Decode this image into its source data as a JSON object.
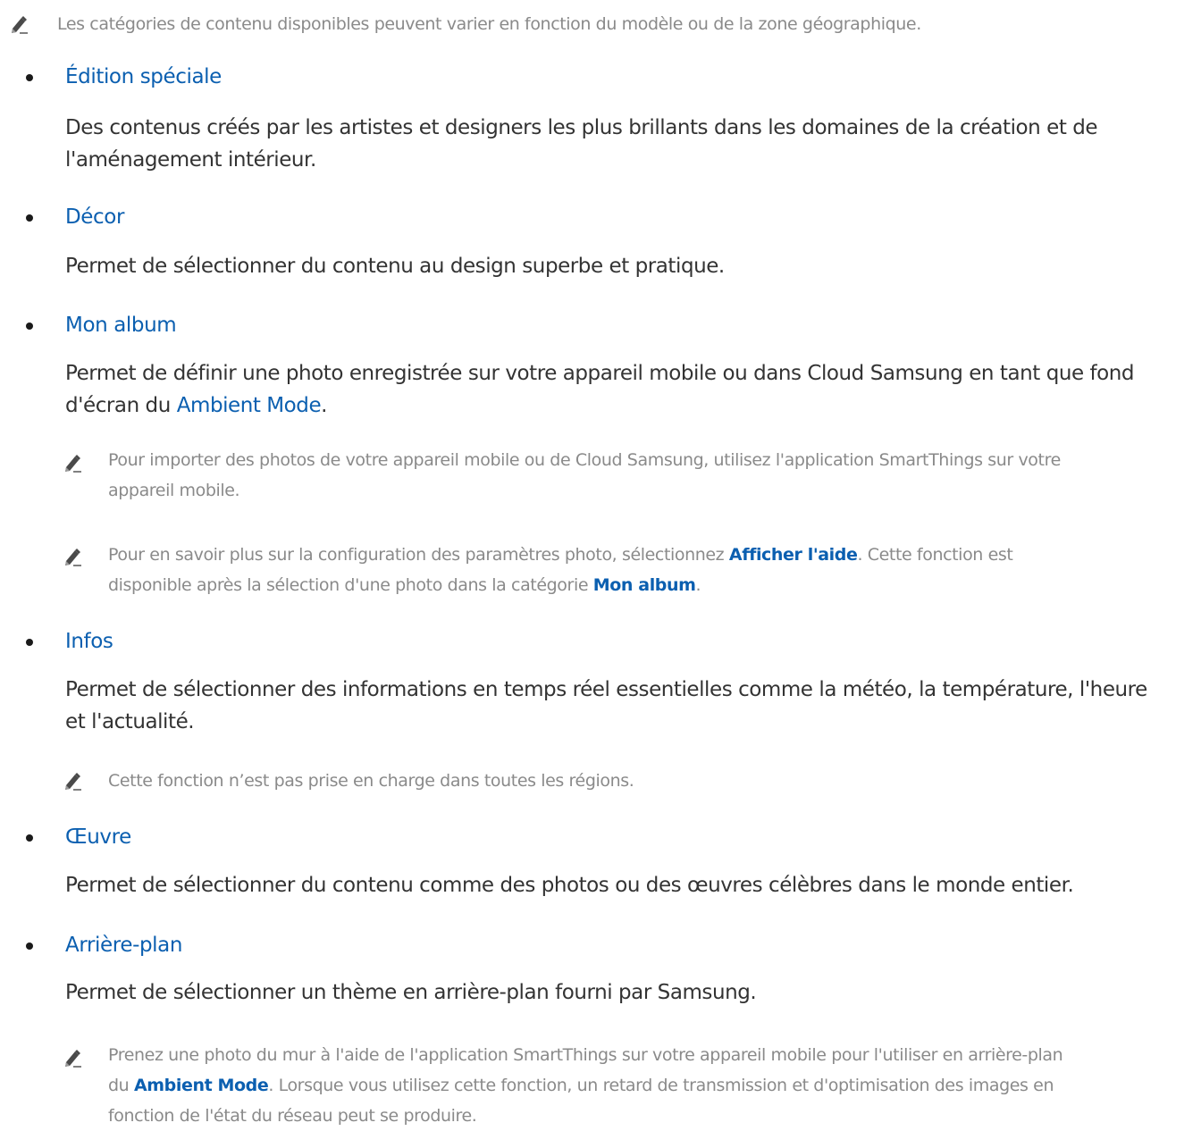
{
  "top_note": "Les catégories de contenu disponibles peuvent varier en fonction du modèle ou de la zone géographique.",
  "sections": [
    {
      "title": "Édition spéciale",
      "body_line1": "Des contenus créés par les artistes et designers les plus brillants dans les domaines de la création et de",
      "body_line2": "l'aménagement intérieur."
    },
    {
      "title": "Décor",
      "body_line1": "Permet de sélectionner du contenu au design superbe et pratique."
    },
    {
      "title": "Mon album",
      "body_line1": "Permet de définir une photo enregistrée sur votre appareil mobile ou dans Cloud Samsung en tant que fond",
      "body_line2_pre": "d'écran du ",
      "body_line2_link": "Ambient Mode",
      "body_line2_post": ".",
      "notes": [
        {
          "line1": "Pour importer des photos de votre appareil mobile ou de Cloud Samsung, utilisez l'application SmartThings sur votre",
          "line2": "appareil mobile."
        },
        {
          "line1_pre": "Pour en savoir plus sur la configuration des paramètres photo, sélectionnez ",
          "line1_link": "Afficher l'aide",
          "line1_post": ". Cette fonction est",
          "line2_pre": "disponible après la sélection d'une photo dans la catégorie ",
          "line2_link": "Mon album",
          "line2_post": "."
        }
      ]
    },
    {
      "title": "Infos",
      "body_line1": "Permet de sélectionner des informations en temps réel essentielles comme la météo, la température, l'heure",
      "body_line2": "et l'actualité.",
      "note": "Cette fonction n’est pas prise en charge dans toutes les régions."
    },
    {
      "title": "Œuvre",
      "body_line1": "Permet de sélectionner du contenu comme des photos ou des œuvres célèbres dans le monde entier."
    },
    {
      "title": "Arrière-plan",
      "body_line1": "Permet de sélectionner un thème en arrière-plan fourni par Samsung.",
      "note": {
        "line1": "Prenez une photo du mur à l'aide de l'application SmartThings sur votre appareil mobile pour l'utiliser en arrière-plan",
        "line2_pre": "du ",
        "line2_link": "Ambient Mode",
        "line2_post": ". Lorsque vous utilisez cette fonction, un retard de transmission et d'optimisation des images en",
        "line3": "fonction de l'état du réseau peut se produire."
      }
    }
  ],
  "icons": {
    "note": "pencil-icon",
    "bullet": "bullet-dot"
  },
  "colors": {
    "link": "#0b5fb0",
    "note_text": "#8a8a8a",
    "body_text": "#333333"
  }
}
